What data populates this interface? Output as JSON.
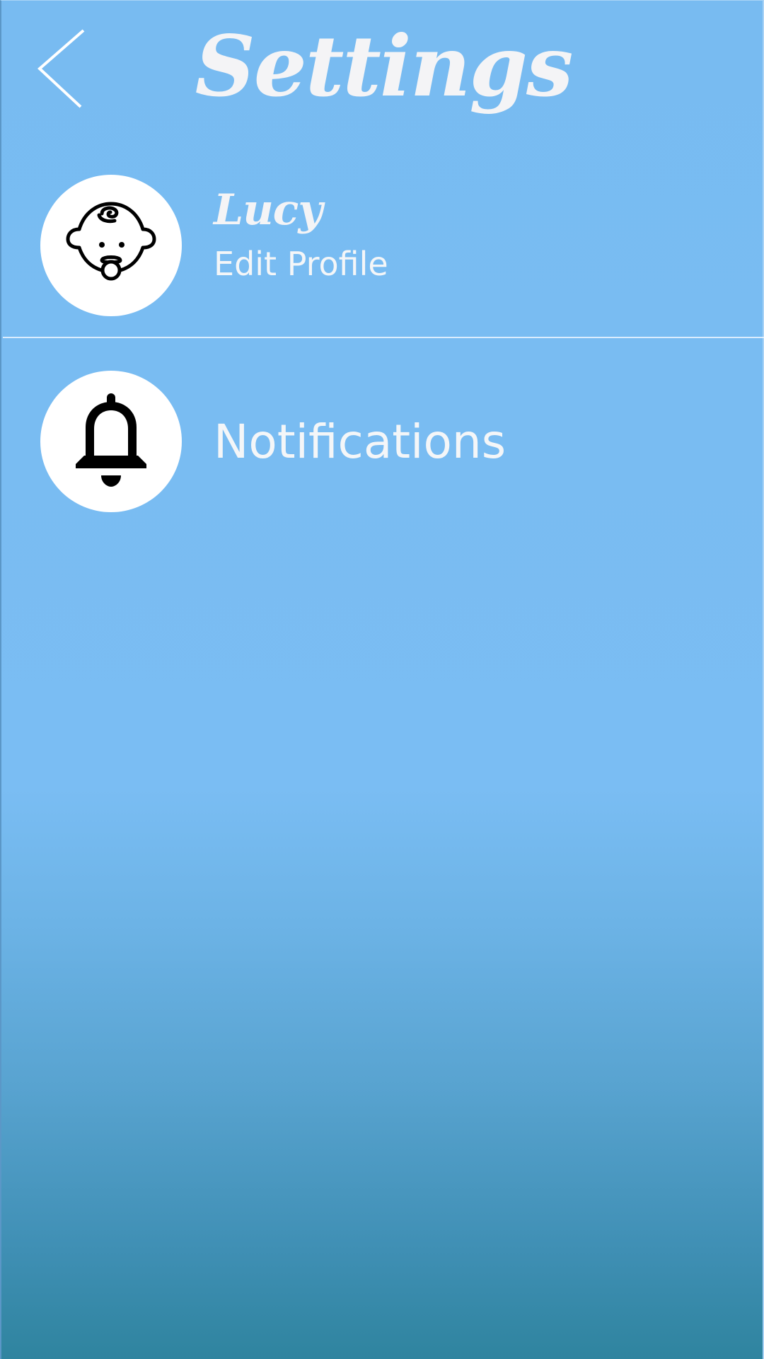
{
  "header": {
    "title": "Settings",
    "back_icon": "chevron-left-icon"
  },
  "profile": {
    "name": "Lucy",
    "subtitle": "Edit Profile",
    "icon": "baby-face-icon"
  },
  "notifications": {
    "label": "Notifications",
    "icon": "bell-icon"
  },
  "colors": {
    "background_top": "#78bbf1",
    "background_bottom": "#2f849f",
    "text": "#f4f4f6",
    "icon_circle": "#ffffff"
  }
}
